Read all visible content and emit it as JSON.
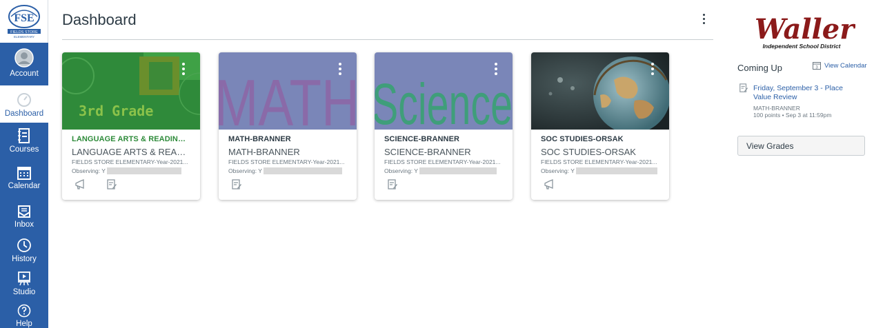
{
  "school_logo": {
    "initials": "FSE",
    "caption": "FIELDS STORE",
    "sub": "ELEMENTARY"
  },
  "nav": [
    {
      "label": "Account",
      "icon": "account-icon"
    },
    {
      "label": "Dashboard",
      "icon": "dashboard-icon"
    },
    {
      "label": "Courses",
      "icon": "courses-icon"
    },
    {
      "label": "Calendar",
      "icon": "calendar-icon"
    },
    {
      "label": "Inbox",
      "icon": "inbox-icon"
    },
    {
      "label": "History",
      "icon": "history-icon"
    },
    {
      "label": "Studio",
      "icon": "studio-icon"
    },
    {
      "label": "Help",
      "icon": "help-icon"
    }
  ],
  "header": {
    "title": "Dashboard"
  },
  "cards": [
    {
      "hero_text": "3rd Grade",
      "title": "LANGUAGE ARTS & READING-O...",
      "title_color": "#2e8b3a",
      "code": "LANGUAGE ARTS & READIN...",
      "term": "FIELDS STORE ELEMENTARY-Year-2021...",
      "observing": "Observing: Y"
    },
    {
      "hero_text": "MATH",
      "title": "MATH-BRANNER",
      "title_color": "#2d3b45",
      "code": "MATH-BRANNER",
      "term": "FIELDS STORE ELEMENTARY-Year-2021...",
      "observing": "Observing: Y"
    },
    {
      "hero_text": "Science",
      "title": "SCIENCE-BRANNER",
      "title_color": "#2d3b45",
      "code": "SCIENCE-BRANNER",
      "term": "FIELDS STORE ELEMENTARY-Year-2021...",
      "observing": "Observing: Y"
    },
    {
      "title": "SOC STUDIES-ORSAK",
      "title_color": "#2d3b45",
      "code": "SOC STUDIES-ORSAK",
      "term": "FIELDS STORE ELEMENTARY-Year-2021...",
      "observing": "Observing: Y"
    }
  ],
  "district": {
    "name": "Waller",
    "sub": "Independent School District"
  },
  "sidebar": {
    "coming_up": "Coming Up",
    "view_calendar": "View Calendar",
    "calendar_day": "3",
    "todo": {
      "title": "Friday, September 3 - Place Value Review",
      "course": "MATH-BRANNER",
      "meta": "100 points • Sep 3 at 11:59pm"
    },
    "view_grades": "View Grades"
  },
  "colors": {
    "nav_bg": "#2b5fa7",
    "link": "#2b5fa7",
    "green_title": "#2e8b3a"
  }
}
